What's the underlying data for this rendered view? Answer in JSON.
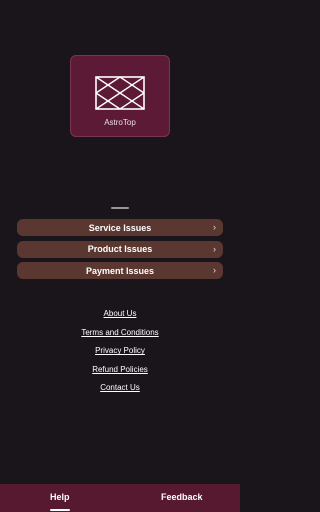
{
  "app": {
    "name": "AstroTop"
  },
  "issues": [
    {
      "label": "Service Issues"
    },
    {
      "label": "Product Issues"
    },
    {
      "label": "Payment Issues"
    }
  ],
  "links": [
    {
      "label": "About Us"
    },
    {
      "label": "Terms and Conditions"
    },
    {
      "label": "Privacy Policy"
    },
    {
      "label": "Refund Policies"
    },
    {
      "label": "Contact Us"
    }
  ],
  "nav": {
    "help": "Help",
    "feedback": "Feedback",
    "active": "help"
  },
  "icons": {
    "logo": "lattice-logo-icon",
    "chevron": "chevron-right-icon"
  },
  "colors": {
    "background": "#19151a",
    "card": "#5c1a36",
    "issue_button": "#5b3731",
    "bottom_nav": "#56192f"
  }
}
